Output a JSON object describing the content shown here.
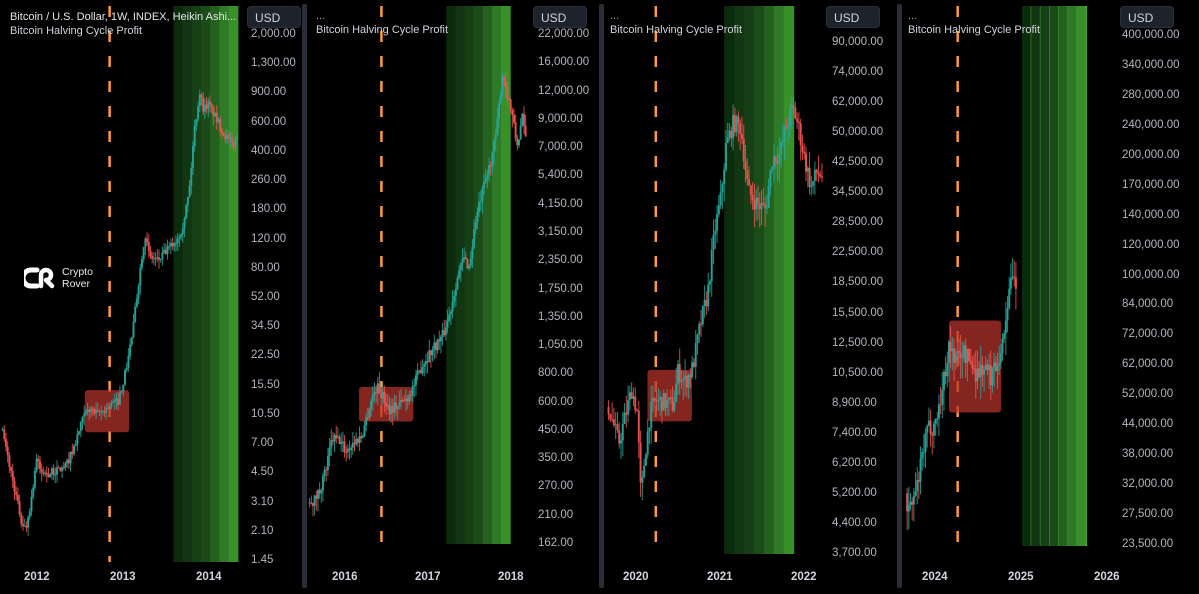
{
  "header": {
    "symbol_title": "Bitcoin / U.S. Dollar, 1W, INDEX, Heikin Ashi...",
    "indicator": "Bitcoin Halving Cycle Profit",
    "collapsed_marker": "..."
  },
  "watermark": {
    "line1": "Crypto",
    "line2": "Rover"
  },
  "currency_label": "USD",
  "colors": {
    "up": "#26a69a",
    "down": "#ef5350",
    "halving_line": "#ff9a3c",
    "accumulation_box": "#b2312b",
    "band_colors": [
      "#0c2a0c",
      "#123512",
      "#173f15",
      "#1c4a19",
      "#24611f",
      "#2e7a26",
      "#379128"
    ]
  },
  "chart_data": [
    {
      "type": "candlestick",
      "title": "Bitcoin / U.S. Dollar, 1W, INDEX, Heikin Ashi",
      "scale": "log",
      "ylim": [
        1.4,
        2200
      ],
      "x_range": [
        "2011-09",
        "2014-05"
      ],
      "x_ticks": [
        {
          "label": "2012",
          "t": 2012.0
        },
        {
          "label": "2013",
          "t": 2013.0
        },
        {
          "label": "2014",
          "t": 2014.0
        }
      ],
      "y_ticks": [
        "2,000.00",
        "1,300.00",
        "900.00",
        "600.00",
        "400.00",
        "260.00",
        "180.00",
        "120.00",
        "80.00",
        "52.00",
        "34.50",
        "22.50",
        "15.50",
        "10.50",
        "7.00",
        "4.50",
        "3.10",
        "2.10",
        "1.45"
      ],
      "y_tick_values": [
        2000,
        1300,
        900,
        600,
        400,
        260,
        180,
        120,
        80,
        52,
        34.5,
        22.5,
        15.5,
        10.5,
        7,
        4.5,
        3.1,
        2.1,
        1.45
      ],
      "halving_date": 2012.9,
      "profit_band": [
        2013.62,
        2014.35
      ],
      "accumulation_box": {
        "t0": 2012.62,
        "t1": 2013.12,
        "low": 8.6,
        "high": 15.5
      },
      "price_path": [
        [
          2011.67,
          9.5
        ],
        [
          2011.75,
          6
        ],
        [
          2011.82,
          4
        ],
        [
          2011.9,
          2.5
        ],
        [
          2011.95,
          2.2
        ],
        [
          2012.02,
          3.5
        ],
        [
          2012.07,
          6.0
        ],
        [
          2012.12,
          4.9
        ],
        [
          2012.2,
          4.8
        ],
        [
          2012.3,
          5.0
        ],
        [
          2012.4,
          5.3
        ],
        [
          2012.5,
          7
        ],
        [
          2012.6,
          10.5
        ],
        [
          2012.68,
          12
        ],
        [
          2012.75,
          11
        ],
        [
          2012.82,
          11.5
        ],
        [
          2012.9,
          12.5
        ],
        [
          2013.0,
          13.4
        ],
        [
          2013.08,
          20
        ],
        [
          2013.16,
          35
        ],
        [
          2013.24,
          80
        ],
        [
          2013.3,
          140
        ],
        [
          2013.35,
          100
        ],
        [
          2013.45,
          95
        ],
        [
          2013.55,
          110
        ],
        [
          2013.65,
          125
        ],
        [
          2013.72,
          150
        ],
        [
          2013.8,
          250
        ],
        [
          2013.86,
          600
        ],
        [
          2013.92,
          1000
        ],
        [
          2013.96,
          800
        ],
        [
          2014.02,
          850
        ],
        [
          2014.1,
          700
        ],
        [
          2014.2,
          550
        ],
        [
          2014.3,
          480
        ],
        [
          2014.36,
          560
        ]
      ]
    },
    {
      "type": "candlestick",
      "title": "Bitcoin Halving Cycle Profit",
      "scale": "log",
      "ylim": [
        150,
        24000
      ],
      "x_range": [
        "2015-09",
        "2018-03"
      ],
      "x_ticks": [
        {
          "label": "2016",
          "t": 2016.0
        },
        {
          "label": "2017",
          "t": 2017.0
        },
        {
          "label": "2018",
          "t": 2018.0
        }
      ],
      "y_ticks": [
        "22,000.00",
        "16,000.00",
        "12,000.00",
        "9,000.00",
        "7,000.00",
        "5,400.00",
        "4,150.00",
        "3,150.00",
        "2,350.00",
        "1,750.00",
        "1,350.00",
        "1,050.00",
        "800.00",
        "600.00",
        "450.00",
        "350.00",
        "270.00",
        "210.00",
        "162.00"
      ],
      "y_tick_values": [
        22000,
        16000,
        12000,
        9000,
        7000,
        5400,
        4150,
        3150,
        2350,
        1750,
        1350,
        1050,
        800,
        600,
        450,
        350,
        270,
        210,
        162
      ],
      "halving_date": 2016.53,
      "profit_band": [
        2017.28,
        2018.02
      ],
      "accumulation_box": {
        "t0": 2016.27,
        "t1": 2016.9,
        "low": 510,
        "high": 720
      },
      "price_path": [
        [
          2015.68,
          240
        ],
        [
          2015.75,
          230
        ],
        [
          2015.82,
          260
        ],
        [
          2015.9,
          330
        ],
        [
          2015.96,
          430
        ],
        [
          2016.05,
          420
        ],
        [
          2016.12,
          380
        ],
        [
          2016.2,
          410
        ],
        [
          2016.3,
          440
        ],
        [
          2016.42,
          650
        ],
        [
          2016.48,
          720
        ],
        [
          2016.55,
          650
        ],
        [
          2016.62,
          580
        ],
        [
          2016.72,
          600
        ],
        [
          2016.82,
          640
        ],
        [
          2016.92,
          750
        ],
        [
          2017.0,
          900
        ],
        [
          2017.08,
          1000
        ],
        [
          2017.16,
          1100
        ],
        [
          2017.24,
          1200
        ],
        [
          2017.32,
          1500
        ],
        [
          2017.4,
          2100
        ],
        [
          2017.48,
          2600
        ],
        [
          2017.55,
          2400
        ],
        [
          2017.62,
          3800
        ],
        [
          2017.7,
          5000
        ],
        [
          2017.78,
          6500
        ],
        [
          2017.86,
          9000
        ],
        [
          2017.93,
          16500
        ],
        [
          2017.98,
          14000
        ],
        [
          2018.04,
          11000
        ],
        [
          2018.1,
          8000
        ],
        [
          2018.16,
          10500
        ],
        [
          2018.2,
          8700
        ]
      ]
    },
    {
      "type": "candlestick",
      "title": "Bitcoin Halving Cycle Profit",
      "scale": "log",
      "ylim": [
        3500,
        98000
      ],
      "x_range": [
        "2019-11",
        "2022-03"
      ],
      "x_ticks": [
        {
          "label": "2020",
          "t": 2020.0
        },
        {
          "label": "2021",
          "t": 2021.0
        },
        {
          "label": "2022",
          "t": 2022.0
        }
      ],
      "y_ticks": [
        "90,000.00",
        "74,000.00",
        "62,000.00",
        "50,000.00",
        "42,500.00",
        "34,500.00",
        "28,500.00",
        "22,500.00",
        "18,500.00",
        "15,500.00",
        "12,500.00",
        "10,500.00",
        "8,900.00",
        "7,400.00",
        "6,200.00",
        "5,200.00",
        "4,400.00",
        "3,700.00"
      ],
      "y_tick_values": [
        90000,
        74000,
        62000,
        50000,
        42500,
        34500,
        28500,
        22500,
        18500,
        15500,
        12500,
        10500,
        8900,
        7400,
        6200,
        5200,
        4400,
        3700
      ],
      "halving_date": 2020.36,
      "profit_band": [
        2021.1,
        2021.85
      ],
      "accumulation_box": {
        "t0": 2020.27,
        "t1": 2020.75,
        "low": 8300,
        "high": 11600
      },
      "price_path": [
        [
          2019.83,
          9400
        ],
        [
          2019.9,
          8200
        ],
        [
          2019.96,
          7200
        ],
        [
          2020.04,
          8800
        ],
        [
          2020.1,
          10200
        ],
        [
          2020.16,
          8800
        ],
        [
          2020.2,
          5000
        ],
        [
          2020.24,
          6600
        ],
        [
          2020.3,
          8800
        ],
        [
          2020.36,
          9500
        ],
        [
          2020.45,
          9400
        ],
        [
          2020.55,
          9200
        ],
        [
          2020.6,
          11500
        ],
        [
          2020.68,
          10700
        ],
        [
          2020.76,
          11800
        ],
        [
          2020.84,
          15500
        ],
        [
          2020.92,
          19000
        ],
        [
          2021.0,
          29000
        ],
        [
          2021.06,
          35000
        ],
        [
          2021.12,
          50000
        ],
        [
          2021.2,
          58000
        ],
        [
          2021.28,
          56000
        ],
        [
          2021.36,
          37000
        ],
        [
          2021.46,
          34000
        ],
        [
          2021.55,
          33000
        ],
        [
          2021.62,
          46000
        ],
        [
          2021.7,
          47000
        ],
        [
          2021.76,
          55000
        ],
        [
          2021.84,
          64000
        ],
        [
          2021.9,
          57000
        ],
        [
          2021.96,
          47000
        ],
        [
          2022.04,
          38000
        ],
        [
          2022.1,
          42000
        ],
        [
          2022.16,
          41000
        ]
      ]
    },
    {
      "type": "candlestick",
      "title": "Bitcoin Halving Cycle Profit",
      "scale": "log",
      "ylim": [
        21000,
        420000
      ],
      "x_range": [
        "2023-09",
        "2026-02"
      ],
      "x_ticks": [
        {
          "label": "2024",
          "t": 2024.0
        },
        {
          "label": "2025",
          "t": 2025.0
        },
        {
          "label": "2026",
          "t": 2026.0
        }
      ],
      "y_ticks": [
        "400,000.00",
        "340,000.00",
        "280,000.00",
        "240,000.00",
        "200,000.00",
        "170,000.00",
        "140,000.00",
        "120,000.00",
        "100,000.00",
        "84,000.00",
        "72,000.00",
        "62,000.00",
        "52,000.00",
        "44,000.00",
        "38,000.00",
        "32,000.00",
        "27,500.00",
        "23,500.00"
      ],
      "y_tick_values": [
        400000,
        340000,
        280000,
        240000,
        200000,
        170000,
        140000,
        120000,
        100000,
        84000,
        72000,
        62000,
        52000,
        44000,
        38000,
        32000,
        27500,
        23500
      ],
      "halving_date": 2024.3,
      "profit_band": [
        2025.04,
        2025.78
      ],
      "accumulation_box": {
        "t0": 2024.2,
        "t1": 2024.8,
        "low": 46000,
        "high": 79000
      },
      "price_path": [
        [
          2023.7,
          27000
        ],
        [
          2023.76,
          26000
        ],
        [
          2023.84,
          30000
        ],
        [
          2023.9,
          36000
        ],
        [
          2023.96,
          42000
        ],
        [
          2024.04,
          43000
        ],
        [
          2024.12,
          52000
        ],
        [
          2024.2,
          68000
        ],
        [
          2024.28,
          63000
        ],
        [
          2024.36,
          66000
        ],
        [
          2024.44,
          62000
        ],
        [
          2024.52,
          58000
        ],
        [
          2024.6,
          60000
        ],
        [
          2024.68,
          57000
        ],
        [
          2024.76,
          63000
        ],
        [
          2024.82,
          69000
        ],
        [
          2024.88,
          92000
        ],
        [
          2024.94,
          100000
        ],
        [
          2024.98,
          96000
        ]
      ]
    }
  ]
}
